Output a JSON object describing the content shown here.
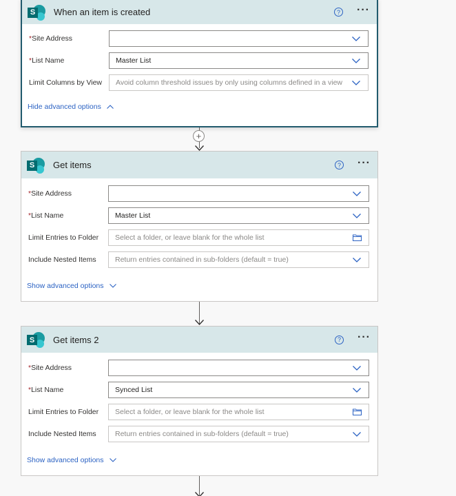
{
  "trigger": {
    "title": "When an item is created",
    "help_glyph": "?",
    "more_glyph": "···",
    "site_label": "Site Address",
    "site_value": "",
    "list_label": "List Name",
    "list_value": "Master List",
    "limit_label": "Limit Columns by View",
    "limit_placeholder": "Avoid column threshold issues by only using columns defined in a view",
    "advanced_link": "Hide advanced options",
    "required_mark": "*"
  },
  "get_items": {
    "title": "Get items",
    "help_glyph": "?",
    "more_glyph": "···",
    "site_label": "Site Address",
    "site_value": "",
    "list_label": "List Name",
    "list_value": "Master List",
    "folder_label": "Limit Entries to Folder",
    "folder_placeholder": "Select a folder, or leave blank for the whole list",
    "nested_label": "Include Nested Items",
    "nested_placeholder": "Return entries contained in sub-folders (default = true)",
    "advanced_link": "Show advanced options",
    "required_mark": "*"
  },
  "get_items_2": {
    "title": "Get items 2",
    "help_glyph": "?",
    "more_glyph": "···",
    "site_label": "Site Address",
    "site_value": "",
    "list_label": "List Name",
    "list_value": "Synced List",
    "folder_label": "Limit Entries to Folder",
    "folder_placeholder": "Select a folder, or leave blank for the whole list",
    "nested_label": "Include Nested Items",
    "nested_placeholder": "Return entries contained in sub-folders (default = true)",
    "advanced_link": "Show advanced options",
    "required_mark": "*"
  },
  "connector": {
    "plus_glyph": "+"
  },
  "icons": {
    "sharepoint": "sharepoint-logo-icon",
    "help": "help-circle-icon",
    "more": "more-options-icon",
    "dropdown": "chevron-down-icon",
    "folder": "folder-icon",
    "chevron_up": "chevron-up-icon"
  },
  "colors": {
    "header_bg": "#d7e7e9",
    "selected_border": "#215a6d",
    "link": "#2b62c3",
    "sharepoint_dark": "#036c70"
  },
  "sp_letter": "S"
}
